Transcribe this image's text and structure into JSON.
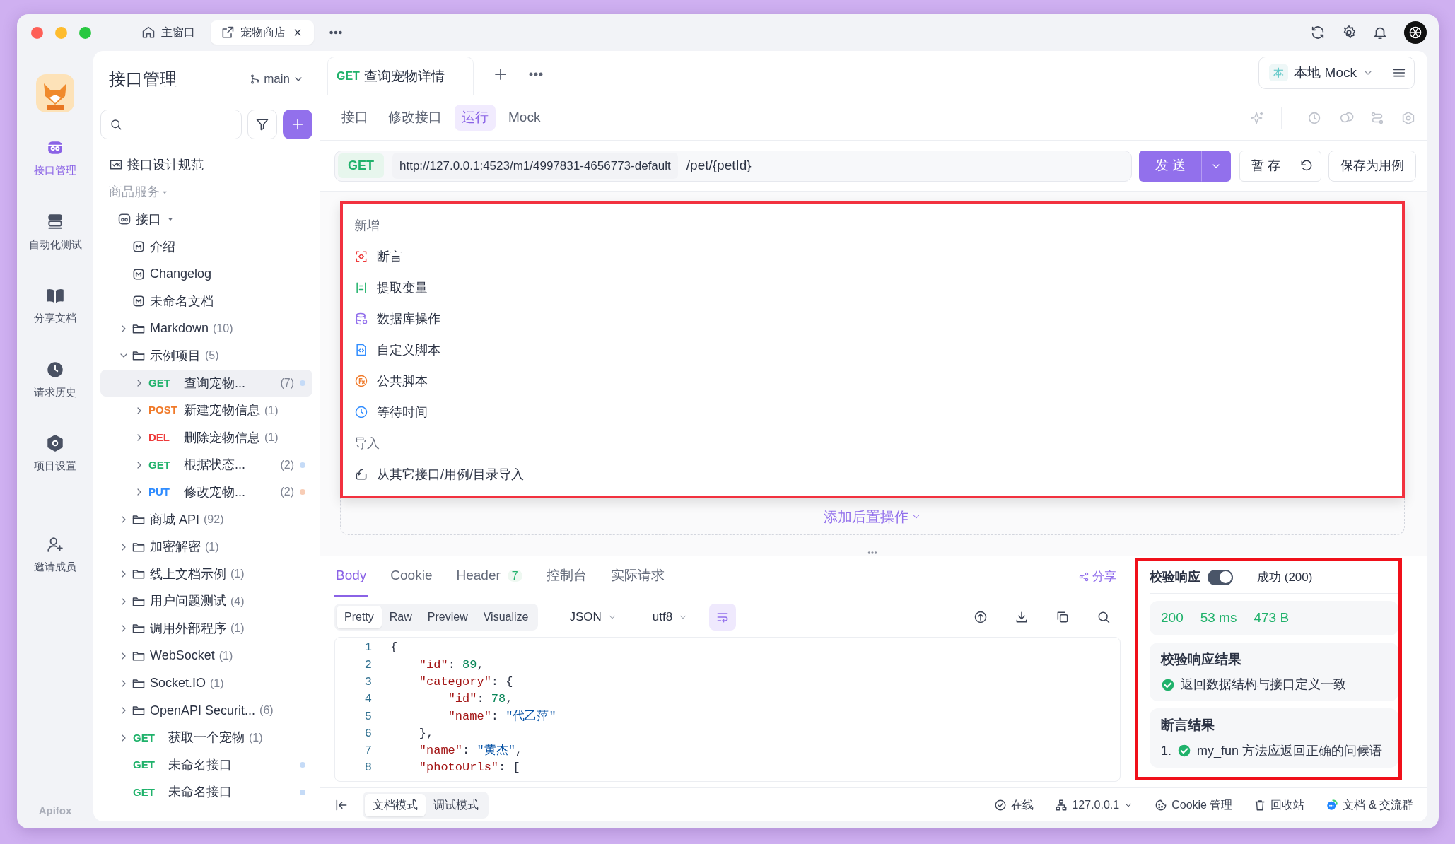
{
  "window": {
    "tabs": [
      {
        "label": "主窗口",
        "kind": "home",
        "selected": false,
        "closable": false
      },
      {
        "label": "宠物商店",
        "kind": "external",
        "selected": true,
        "closable": true
      }
    ]
  },
  "rail": {
    "items": [
      {
        "label": "接口管理",
        "kind": "api",
        "selected": true
      },
      {
        "label": "自动化测试",
        "kind": "test",
        "selected": false
      },
      {
        "label": "分享文档",
        "kind": "book",
        "selected": false
      },
      {
        "label": "请求历史",
        "kind": "history",
        "selected": false
      },
      {
        "label": "项目设置",
        "kind": "settings",
        "selected": false
      },
      {
        "label": "邀请成员",
        "kind": "invite",
        "selected": false
      }
    ],
    "brand": "Apifox"
  },
  "sidebar": {
    "title": "接口管理",
    "branch": "main",
    "spec_link": "接口设计规范",
    "group": "商品服务",
    "tree": [
      {
        "kind": "root",
        "label": "接口",
        "expanded": true,
        "selected": false,
        "children": [
          {
            "kind": "doc",
            "label": "介绍",
            "selected": false
          },
          {
            "kind": "doc",
            "label": "Changelog",
            "selected": false
          },
          {
            "kind": "doc",
            "label": "未命名文档",
            "selected": false
          },
          {
            "kind": "folder",
            "label": "Markdown",
            "count": "(10)",
            "expanded": false,
            "selected": false
          },
          {
            "kind": "folder",
            "label": "示例项目",
            "count": "(5)",
            "expanded": true,
            "selected": false,
            "children": [
              {
                "kind": "get",
                "method": "GET",
                "label": "查询宠物...",
                "count": "(7)",
                "expanded": false,
                "selected": true,
                "color": "#c5dbf7"
              },
              {
                "kind": "post",
                "method": "POST",
                "label": "新建宠物信息",
                "count": "(1)",
                "expanded": false,
                "selected": false
              },
              {
                "kind": "delete",
                "method": "DEL",
                "label": "删除宠物信息",
                "count": "(1)",
                "expanded": false,
                "selected": false
              },
              {
                "kind": "get",
                "method": "GET",
                "label": "根据状态...",
                "count": "(2)",
                "expanded": false,
                "selected": false,
                "color": "#c5dbf7"
              },
              {
                "kind": "put",
                "method": "PUT",
                "label": "修改宠物...",
                "count": "(2)",
                "expanded": false,
                "selected": false,
                "color": "#f8cdb6"
              }
            ]
          },
          {
            "kind": "folder",
            "label": "商城 API",
            "count": "(92)",
            "expanded": false,
            "selected": false
          },
          {
            "kind": "folder",
            "label": "加密解密",
            "count": "(1)",
            "expanded": false,
            "selected": false
          },
          {
            "kind": "folder",
            "label": "线上文档示例",
            "count": "(1)",
            "expanded": false,
            "selected": false
          },
          {
            "kind": "folder",
            "label": "用户问题测试",
            "count": "(4)",
            "expanded": false,
            "selected": false
          },
          {
            "kind": "folder",
            "label": "调用外部程序",
            "count": "(1)",
            "expanded": false,
            "selected": false
          },
          {
            "kind": "folder",
            "label": "WebSocket",
            "count": "(1)",
            "expanded": false,
            "selected": false
          },
          {
            "kind": "folder",
            "label": "Socket.IO",
            "count": "(1)",
            "expanded": false,
            "selected": false
          },
          {
            "kind": "folder",
            "label": "OpenAPI Securit...",
            "count": "(6)",
            "expanded": false,
            "selected": false
          },
          {
            "kind": "get",
            "method": "GET",
            "label": "获取一个宠物",
            "count": "(1)",
            "expanded": false,
            "selected": false
          },
          {
            "kind": "get",
            "method": "GET",
            "label": "未命名接口",
            "selected": false,
            "color": "#c5dbf7"
          },
          {
            "kind": "get",
            "method": "GET",
            "label": "未命名接口",
            "selected": false,
            "color": "#c5dbf7"
          }
        ]
      }
    ]
  },
  "editor_tabs": [
    {
      "method": "GET",
      "label": "查询宠物详情",
      "selected": true
    }
  ],
  "environment": {
    "badge": "本",
    "label": "本地 Mock"
  },
  "subtabs": [
    {
      "label": "接口",
      "selected": false
    },
    {
      "label": "修改接口",
      "selected": false
    },
    {
      "label": "运行",
      "selected": true
    },
    {
      "label": "Mock",
      "selected": false
    }
  ],
  "request": {
    "method": "GET",
    "base_url": "http://127.0.0.1:4523/m1/4997831-4656773-default",
    "path": "/pet/{petId}",
    "send": "发 送",
    "save": "暂 存",
    "save_case": "保存为用例"
  },
  "add_menu": {
    "sections": [
      {
        "title": "新增",
        "items": [
          {
            "label": "断言",
            "kind": "assert"
          },
          {
            "label": "提取变量",
            "kind": "extract"
          },
          {
            "label": "数据库操作",
            "kind": "database"
          },
          {
            "label": "自定义脚本",
            "kind": "script"
          },
          {
            "label": "公共脚本",
            "kind": "function"
          },
          {
            "label": "等待时间",
            "kind": "wait"
          }
        ]
      },
      {
        "title": "导入",
        "items": [
          {
            "label": "从其它接口/用例/目录导入",
            "kind": "import"
          }
        ]
      }
    ]
  },
  "add_post_action": "添加后置操作",
  "response": {
    "tabs": [
      {
        "label": "Body",
        "selected": true
      },
      {
        "label": "Cookie",
        "selected": false
      },
      {
        "label": "Header",
        "count": "7",
        "selected": false
      },
      {
        "label": "控制台",
        "selected": false
      },
      {
        "label": "实际请求",
        "selected": false
      }
    ],
    "share": "分享",
    "views": [
      {
        "label": "Pretty",
        "selected": true
      },
      {
        "label": "Raw",
        "selected": false
      },
      {
        "label": "Preview",
        "selected": false
      },
      {
        "label": "Visualize",
        "selected": false
      }
    ],
    "format": "JSON",
    "encoding": "utf8",
    "wrap": true,
    "lines": [
      {
        "number": "1",
        "text": "{"
      },
      {
        "number": "2",
        "text": "    \"id\": 89,"
      },
      {
        "number": "3",
        "text": "    \"category\": {"
      },
      {
        "number": "4",
        "text": "        \"id\": 78,"
      },
      {
        "number": "5",
        "text": "        \"name\": \"代乙萍\""
      },
      {
        "number": "6",
        "text": "    },"
      },
      {
        "number": "7",
        "text": "    \"name\": \"黄杰\","
      },
      {
        "number": "8",
        "text": "    \"photoUrls\": ["
      }
    ]
  },
  "validation": {
    "label": "校验响应",
    "on": true,
    "status": "成功 (200)",
    "metrics": [
      "200",
      "53 ms",
      "473 B"
    ],
    "result_title": "校验响应结果",
    "results": [
      {
        "text": "返回数据结构与接口定义一致",
        "passed": true
      }
    ],
    "assert_title": "断言结果",
    "assertions": [
      {
        "index": "1.",
        "text": "my_fun 方法应返回正确的问候语",
        "passed": true
      }
    ]
  },
  "status_bar": {
    "modes": [
      {
        "label": "文档模式",
        "selected": true
      },
      {
        "label": "调试模式",
        "selected": false
      }
    ],
    "items": [
      {
        "label": "在线",
        "kind": "online"
      },
      {
        "label": "127.0.0.1",
        "kind": "server"
      },
      {
        "label": "Cookie 管理",
        "kind": "cookie"
      },
      {
        "label": "回收站",
        "kind": "trash"
      },
      {
        "label": "文档 & 交流群",
        "kind": "chat"
      }
    ]
  }
}
